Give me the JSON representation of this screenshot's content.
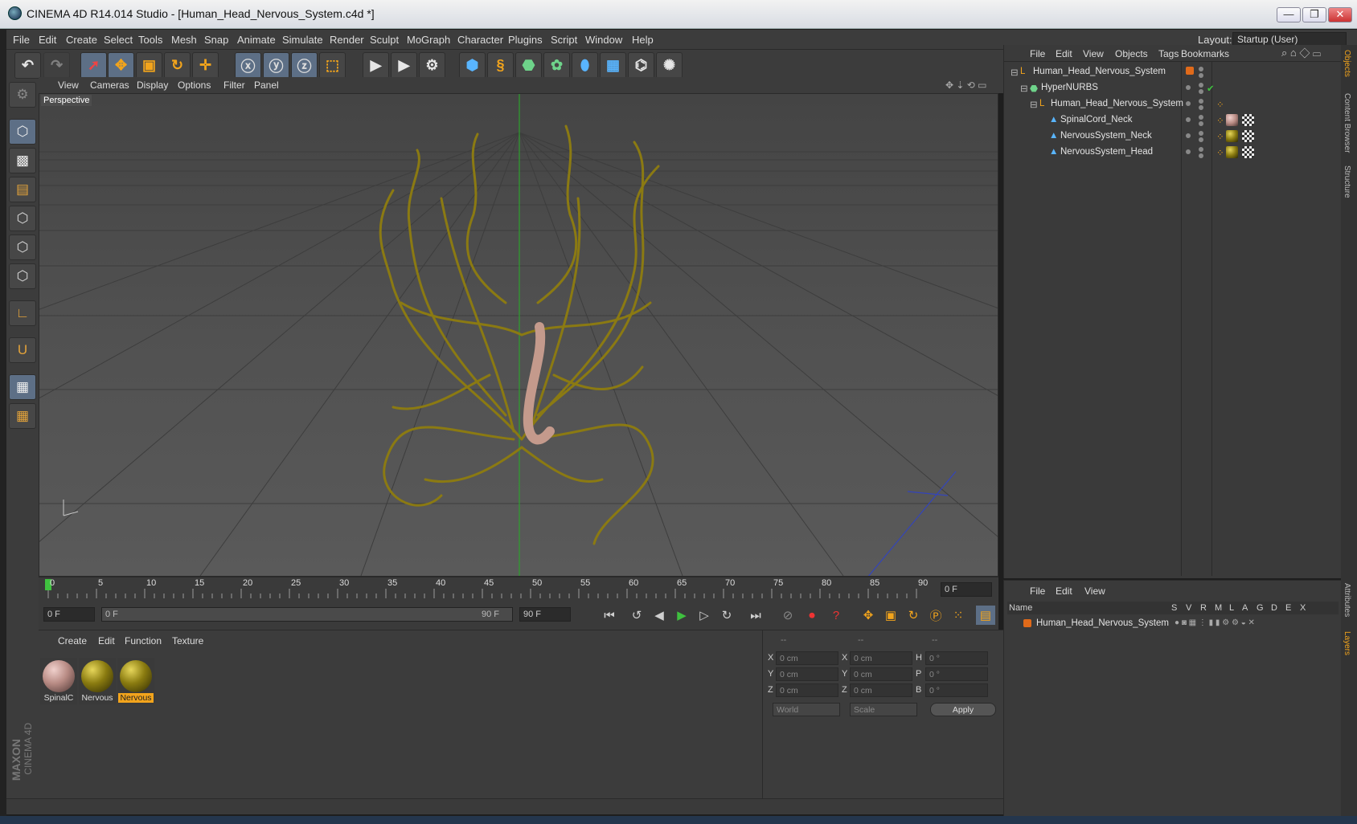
{
  "window": {
    "title": "CINEMA 4D R14.014 Studio - [Human_Head_Nervous_System.c4d *]",
    "minimize": "—",
    "restore": "❐",
    "close": "✕"
  },
  "menubar": {
    "items": [
      "File",
      "Edit",
      "Create",
      "Select",
      "Tools",
      "Mesh",
      "Snap",
      "Animate",
      "Simulate",
      "Render",
      "Sculpt",
      "MoGraph",
      "Character",
      "Plugins",
      "Script",
      "Window",
      "Help"
    ],
    "layout_label": "Layout:",
    "layout_value": "Startup (User)"
  },
  "viewport": {
    "menu": [
      "View",
      "Cameras",
      "Display",
      "Options",
      "Filter",
      "Panel"
    ],
    "camera_label": "Perspective"
  },
  "timeline": {
    "ticks": [
      "0",
      "5",
      "10",
      "15",
      "20",
      "25",
      "30",
      "35",
      "40",
      "45",
      "50",
      "55",
      "60",
      "65",
      "70",
      "75",
      "80",
      "85",
      "90"
    ],
    "current_frame": "0 F"
  },
  "transport": {
    "start_field": "0 F",
    "range_start": "0 F",
    "range_end": "90 F",
    "end_field": "90 F"
  },
  "material_manager": {
    "menu": [
      "Create",
      "Edit",
      "Function",
      "Texture"
    ],
    "materials": [
      {
        "label": "SpinalC",
        "color": "#b88b84"
      },
      {
        "label": "Nervous",
        "color": "#8a7b10"
      },
      {
        "label": "Nervous",
        "color": "#8a7b10",
        "selected": true
      }
    ]
  },
  "coordinates": {
    "headers": [
      "--",
      "--",
      "--"
    ],
    "rows": [
      {
        "axis1": "X",
        "v1": "0 cm",
        "axis2": "X",
        "v2": "0 cm",
        "axis3": "H",
        "v3": "0 °"
      },
      {
        "axis1": "Y",
        "v1": "0 cm",
        "axis2": "Y",
        "v2": "0 cm",
        "axis3": "P",
        "v3": "0 °"
      },
      {
        "axis1": "Z",
        "v1": "0 cm",
        "axis2": "Z",
        "v2": "0 cm",
        "axis3": "B",
        "v3": "0 °"
      }
    ],
    "mode": "World",
    "type": "Scale",
    "apply": "Apply"
  },
  "object_manager": {
    "menu": [
      "File",
      "Edit",
      "View",
      "Objects",
      "Tags",
      "Bookmarks"
    ],
    "objects": [
      {
        "name": "Human_Head_Nervous_System"
      },
      {
        "name": "HyperNURBS"
      },
      {
        "name": "Human_Head_Nervous_System"
      },
      {
        "name": "SpinalCord_Neck"
      },
      {
        "name": "NervousSystem_Neck"
      },
      {
        "name": "NervousSystem_Head"
      }
    ]
  },
  "layer_manager": {
    "menu": [
      "File",
      "Edit",
      "View"
    ],
    "columns": [
      "Name",
      "S",
      "V",
      "R",
      "M",
      "L",
      "A",
      "G",
      "D",
      "E",
      "X"
    ],
    "layers": [
      {
        "name": "Human_Head_Nervous_System",
        "color": "#e06a1a"
      }
    ]
  },
  "right_tabs": [
    "Objects",
    "Content Browser",
    "Structure",
    "Attributes",
    "Layers"
  ],
  "brand": {
    "line1": "MAXON",
    "line2": "CINEMA 4D"
  }
}
